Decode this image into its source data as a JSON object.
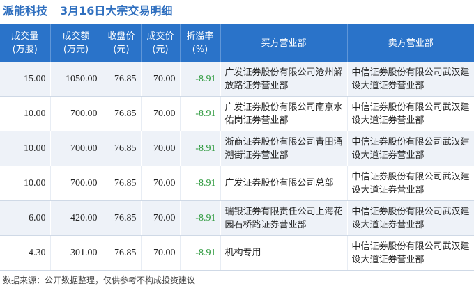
{
  "header": {
    "stock_name": "派能科技",
    "subtitle": "3月16日大宗交易明细"
  },
  "columns": [
    {
      "line1": "成交量",
      "line2": "(万股)"
    },
    {
      "line1": "成交额",
      "line2": "(万元)"
    },
    {
      "line1": "收盘价",
      "line2": "(元)"
    },
    {
      "line1": "成交价",
      "line2": "(元)"
    },
    {
      "line1": "折溢率",
      "line2": "(%)"
    },
    {
      "line1": "买方营业部",
      "line2": ""
    },
    {
      "line1": "卖方营业部",
      "line2": ""
    }
  ],
  "rows": [
    {
      "volume": "15.00",
      "amount": "1050.00",
      "close": "76.85",
      "price": "70.00",
      "premium": "-8.91",
      "buyer": "广发证券股份有限公司沧州解放路证券营业部",
      "seller": "中信证券股份有限公司武汉建设大道证券营业部"
    },
    {
      "volume": "10.00",
      "amount": "700.00",
      "close": "76.85",
      "price": "70.00",
      "premium": "-8.91",
      "buyer": "广发证券股份有限公司南京水佑岗证券营业部",
      "seller": "中信证券股份有限公司武汉建设大道证券营业部"
    },
    {
      "volume": "10.00",
      "amount": "700.00",
      "close": "76.85",
      "price": "70.00",
      "premium": "-8.91",
      "buyer": "浙商证券股份有限公司青田涌潮街证券营业部",
      "seller": "中信证券股份有限公司武汉建设大道证券营业部"
    },
    {
      "volume": "10.00",
      "amount": "700.00",
      "close": "76.85",
      "price": "70.00",
      "premium": "-8.91",
      "buyer": "广发证券股份有限公司总部",
      "seller": "中信证券股份有限公司武汉建设大道证券营业部"
    },
    {
      "volume": "6.00",
      "amount": "420.00",
      "close": "76.85",
      "price": "70.00",
      "premium": "-8.91",
      "buyer": "瑞银证券有限责任公司上海花园石桥路证券营业部",
      "seller": "中信证券股份有限公司武汉建设大道证券营业部"
    },
    {
      "volume": "4.30",
      "amount": "301.00",
      "close": "76.85",
      "price": "70.00",
      "premium": "-8.91",
      "buyer": "机构专用",
      "seller": "中信证券股份有限公司武汉建设大道证券营业部"
    }
  ],
  "footer": {
    "text": "数据来源：公开数据整理，仅供参考不构成投资建议"
  },
  "colors": {
    "title": "#2f6fbf",
    "header_bg": "#2a73c9",
    "premium": "#2e9a3e",
    "row_alt": "#eef2f8"
  }
}
